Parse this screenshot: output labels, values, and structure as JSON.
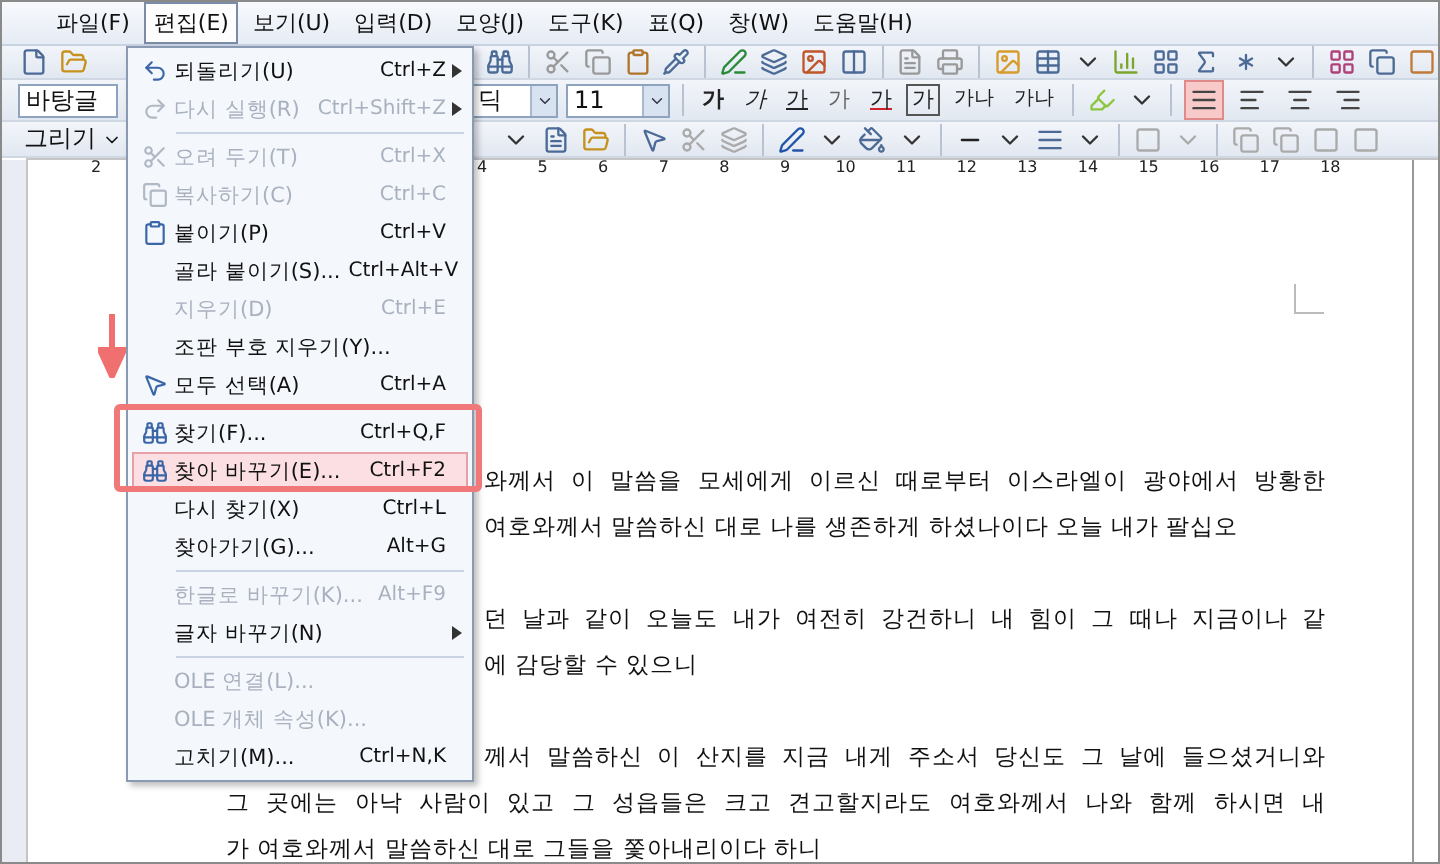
{
  "menu_bar": [
    {
      "label": "파일(F)",
      "selected": false
    },
    {
      "label": "편집(E)",
      "selected": true
    },
    {
      "label": "보기(U)",
      "selected": false
    },
    {
      "label": "입력(D)",
      "selected": false
    },
    {
      "label": "모양(J)",
      "selected": false
    },
    {
      "label": "도구(K)",
      "selected": false
    },
    {
      "label": "표(Q)",
      "selected": false
    },
    {
      "label": "창(W)",
      "selected": false
    },
    {
      "label": "도움말(H)",
      "selected": false
    }
  ],
  "toolbar": {
    "style_box": "바탕글",
    "font_box": "딕",
    "size_box": "11",
    "draw_menu": "그리기",
    "format_buttons": [
      {
        "label": "가",
        "kind": "bold"
      },
      {
        "label": "가",
        "kind": "italic"
      },
      {
        "label": "가",
        "kind": "underline"
      },
      {
        "label": "가",
        "kind": "outline"
      },
      {
        "label": "가",
        "kind": "color"
      },
      {
        "label": "가",
        "kind": "boxed"
      },
      {
        "label": "가나",
        "kind": "narrow"
      },
      {
        "label": "가나",
        "kind": "wide"
      }
    ],
    "alignment": [
      {
        "selected": true
      },
      {
        "selected": false
      },
      {
        "selected": false
      },
      {
        "selected": false
      }
    ]
  },
  "ruler": [
    "2",
    "4",
    "5",
    "6",
    "7",
    "8",
    "9",
    "10",
    "11",
    "12",
    "13",
    "14",
    "15",
    "16",
    "17",
    "18"
  ],
  "edit_menu": [
    {
      "kind": "item",
      "label": "되돌리기(U)",
      "shortcut": "Ctrl+Z",
      "disabled": false,
      "submenu": true,
      "selected": false
    },
    {
      "kind": "item",
      "label": "다시 실행(R)",
      "shortcut": "Ctrl+Shift+Z",
      "disabled": true,
      "submenu": true,
      "selected": false
    },
    {
      "kind": "separator"
    },
    {
      "kind": "item",
      "label": "오려 두기(T)",
      "shortcut": "Ctrl+X",
      "disabled": true,
      "submenu": false,
      "selected": false
    },
    {
      "kind": "item",
      "label": "복사하기(C)",
      "shortcut": "Ctrl+C",
      "disabled": true,
      "submenu": false,
      "selected": false
    },
    {
      "kind": "item",
      "label": "붙이기(P)",
      "shortcut": "Ctrl+V",
      "disabled": false,
      "submenu": false,
      "selected": false
    },
    {
      "kind": "item",
      "label": "골라 붙이기(S)...",
      "shortcut": "Ctrl+Alt+V",
      "disabled": false,
      "submenu": false,
      "selected": false
    },
    {
      "kind": "item",
      "label": "지우기(D)",
      "shortcut": "Ctrl+E",
      "disabled": true,
      "submenu": false,
      "selected": false
    },
    {
      "kind": "item",
      "label": "조판 부호 지우기(Y)...",
      "disabled": false,
      "submenu": false,
      "selected": false
    },
    {
      "kind": "item",
      "label": "모두 선택(A)",
      "shortcut": "Ctrl+A",
      "disabled": false,
      "submenu": false,
      "selected": false
    },
    {
      "kind": "separator"
    },
    {
      "kind": "item",
      "label": "찾기(F)...",
      "shortcut": "Ctrl+Q,F",
      "disabled": false,
      "submenu": false,
      "selected": false
    },
    {
      "kind": "item",
      "label": "찾아 바꾸기(E)...",
      "shortcut": "Ctrl+F2",
      "disabled": false,
      "submenu": false,
      "selected": true
    },
    {
      "kind": "item",
      "label": "다시 찾기(X)",
      "shortcut": "Ctrl+L",
      "disabled": false,
      "submenu": false,
      "selected": false
    },
    {
      "kind": "item",
      "label": "찾아가기(G)...",
      "shortcut": "Alt+G",
      "disabled": false,
      "submenu": false,
      "selected": false
    },
    {
      "kind": "separator"
    },
    {
      "kind": "item",
      "label": "한글로 바꾸기(K)...",
      "shortcut": "Alt+F9",
      "disabled": true,
      "submenu": false,
      "selected": false
    },
    {
      "kind": "item",
      "label": "글자 바꾸기(N)",
      "disabled": false,
      "submenu": true,
      "selected": false
    },
    {
      "kind": "separator"
    },
    {
      "kind": "item",
      "label": "OLE 연결(L)...",
      "disabled": true,
      "submenu": false,
      "selected": false
    },
    {
      "kind": "item",
      "label": "OLE 개체 속성(K)...",
      "disabled": true,
      "submenu": false,
      "selected": false
    },
    {
      "kind": "item",
      "label": "고치기(M)...",
      "shortcut": "Ctrl+N,K",
      "disabled": false,
      "submenu": false,
      "selected": false
    }
  ],
  "document": {
    "paragraphs": [
      {
        "lines": [
          {
            "text": "와께서 이 말씀을 모세에게 이르신 때로부터 이스라엘이 광야에서 방황한",
            "clipped": true
          },
          {
            "text": "여호와께서 말씀하신 대로 나를 생존하게 하셨나이다 오늘 내가 팔십오",
            "clipped": true
          }
        ]
      },
      {
        "lines": [
          {
            "text": "던 날과 같이 오늘도 내가 여전히 강건하니 내 힘이 그 때나 지금이나 같",
            "clipped": true
          },
          {
            "text": "에 감당할 수 있으니",
            "clipped": true
          }
        ]
      },
      {
        "lines": [
          {
            "text": "께서 말씀하신 이 산지를 지금 내게 주소서 당신도 그 날에 들으셨거니와",
            "clipped": true
          },
          {
            "text": "그 곳에는 아낙 사람이 있고 그 성읍들은 크고 견고할지라도 여호와께서 나와 함께 하시면 내",
            "clipped": false
          },
          {
            "text": "가 여호와께서 말씀하신 대로 그들을 쫓아내리이다 하니",
            "clipped": false
          }
        ]
      }
    ]
  }
}
